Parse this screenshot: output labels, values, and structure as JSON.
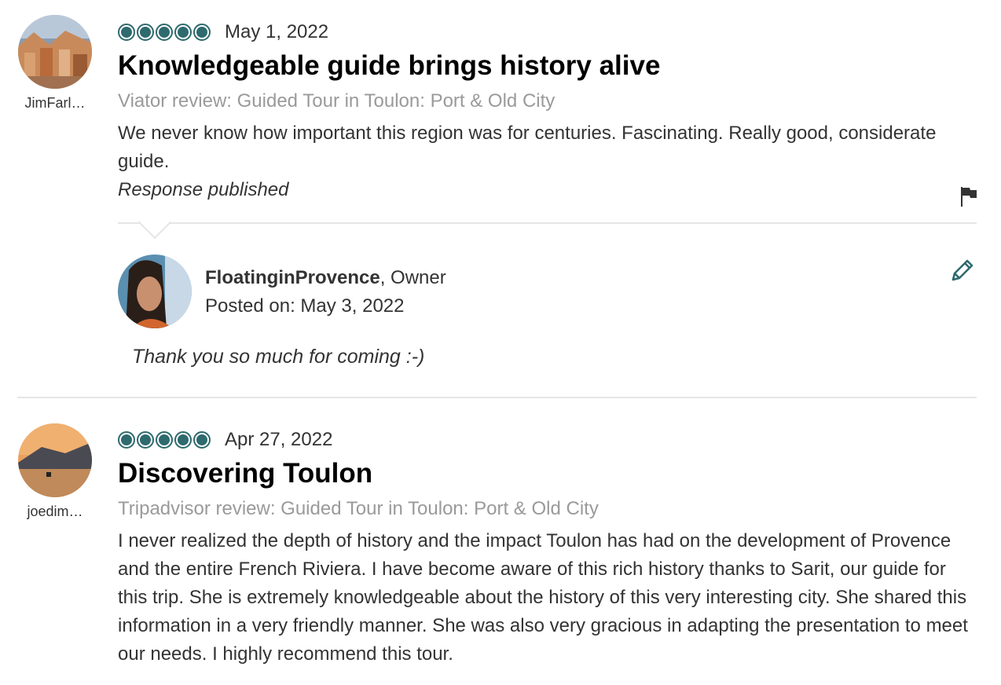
{
  "reviews": [
    {
      "username": "JimFarl…",
      "rating": 5,
      "date": "May 1, 2022",
      "title": "Knowledgeable guide brings history alive",
      "source": "Viator review: Guided Tour in Toulon: Port & Old City",
      "text": "We never know how important this region was for centuries. Fascinating. Really good, considerate guide.",
      "response_status": "Response published",
      "response": {
        "name": "FloatinginProvence",
        "role": ", Owner",
        "posted_label": "Posted on: ",
        "posted_date": "May 3, 2022",
        "text": "Thank you so much for coming :-)"
      }
    },
    {
      "username": "joedim…",
      "rating": 5,
      "date": "Apr 27, 2022",
      "title": "Discovering Toulon",
      "source": "Tripadvisor review: Guided Tour in Toulon: Port & Old City",
      "text": "I never realized the depth of history and the impact Toulon has had on the development of Provence and the entire French Riviera. I have become aware of this rich history thanks to Sarit, our guide for this trip. She is extremely knowledgeable about the history of this very interesting city. She shared this information in a very friendly manner. She was also very gracious in adapting the presentation to meet our needs. I highly recommend this tour."
    }
  ],
  "colors": {
    "bubble": "#2e6a6e",
    "source_text": "#9a9a9a",
    "divider": "#e6e6e6"
  },
  "icons": [
    "flag-icon",
    "edit-pencil-icon",
    "rating-bubble-icon"
  ]
}
